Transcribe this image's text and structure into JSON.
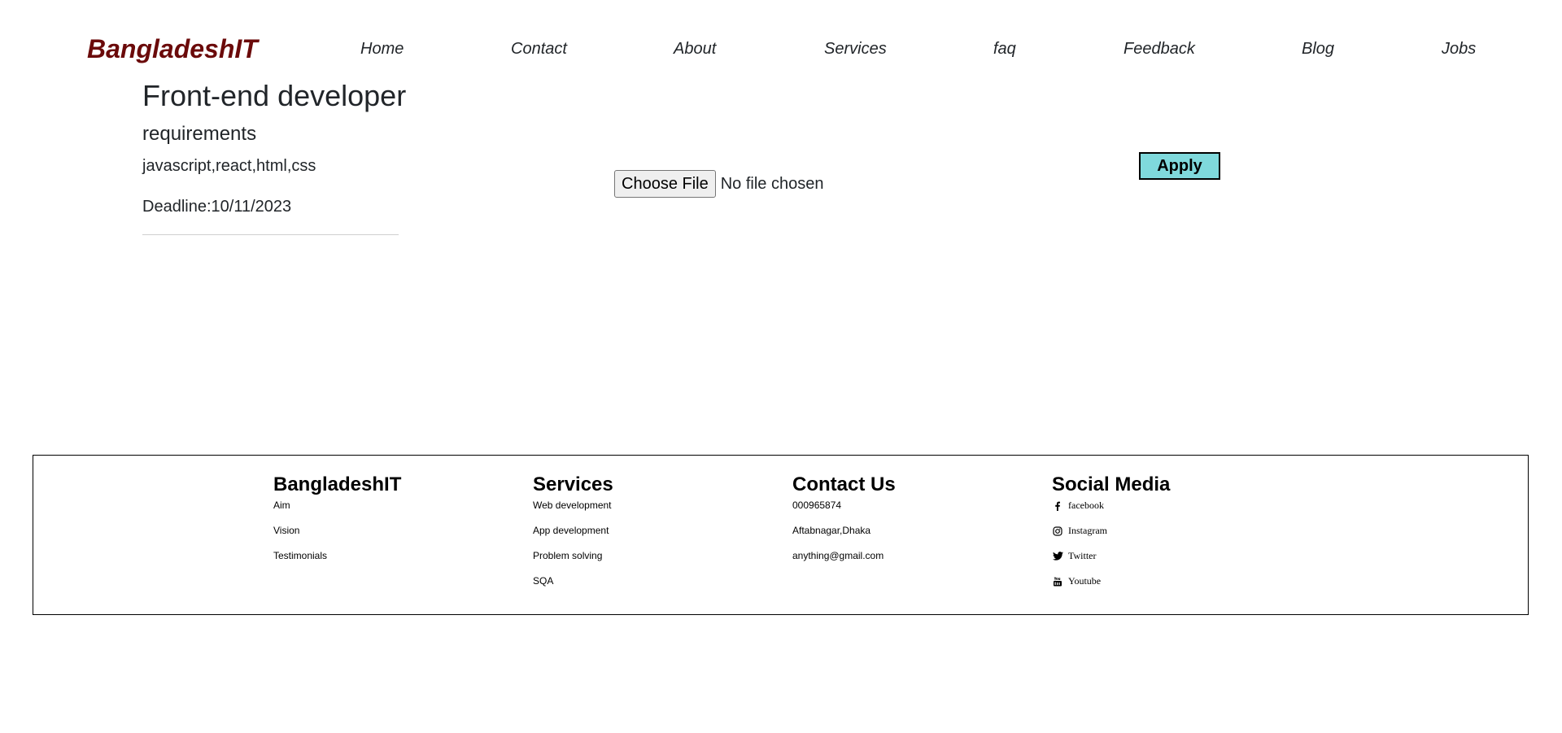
{
  "header": {
    "brand": "BangladeshIT",
    "nav": [
      "Home",
      "Contact",
      "About",
      "Services",
      "faq",
      "Feedback",
      "Blog",
      "Jobs"
    ]
  },
  "job": {
    "title": "Front-end developer",
    "requirements_heading": "requirements",
    "skills": "javascript,react,html,css",
    "deadline_label": "Deadline:",
    "deadline_value": "10/11/2023",
    "file_button": "Choose File",
    "file_status": "No file chosen",
    "apply_label": "Apply"
  },
  "footer": {
    "about": {
      "heading": "BangladeshIT",
      "links": [
        "Aim",
        "Vision",
        "Testimonials"
      ]
    },
    "services": {
      "heading": "Services",
      "links": [
        "Web development",
        "App development",
        "Problem solving",
        "SQA"
      ]
    },
    "contact": {
      "heading": "Contact Us",
      "items": [
        "000965874",
        "Aftabnagar,Dhaka",
        "anything@gmail.com"
      ]
    },
    "social": {
      "heading": "Social Media",
      "items": [
        {
          "label": "facebook",
          "icon": "facebook-icon"
        },
        {
          "label": "Instagram",
          "icon": "instagram-icon"
        },
        {
          "label": "Twitter",
          "icon": "twitter-icon"
        },
        {
          "label": "Youtube",
          "icon": "youtube-icon"
        }
      ]
    }
  },
  "colors": {
    "brand": "#6b0a0a",
    "apply_button_bg": "#7fd9dc"
  }
}
